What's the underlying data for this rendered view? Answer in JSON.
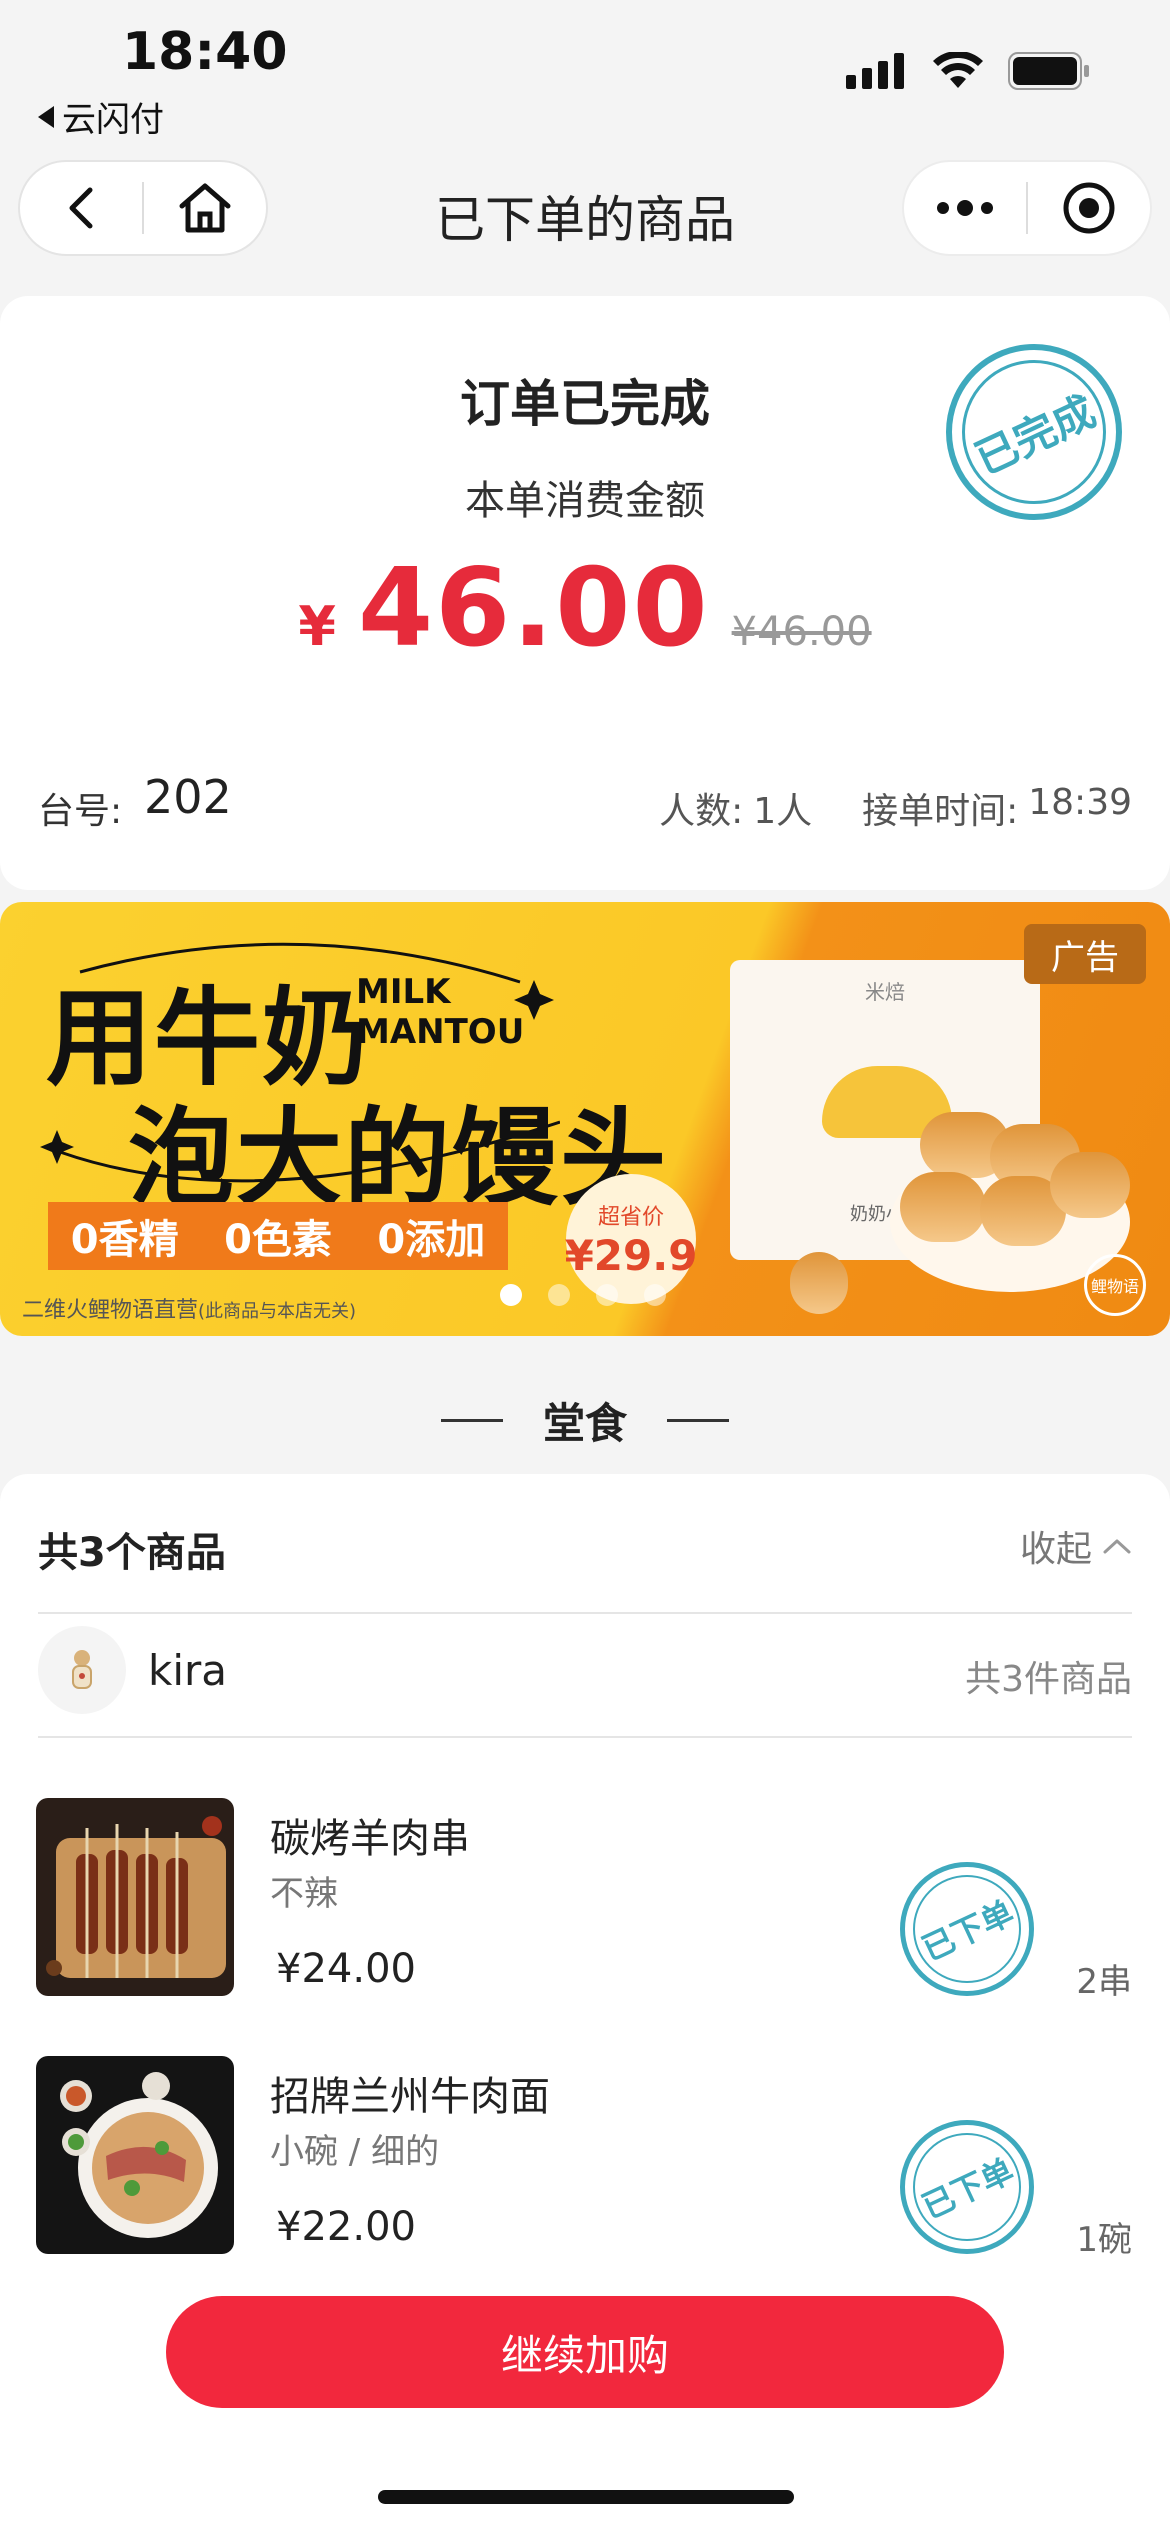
{
  "status_bar": {
    "time": "18:40",
    "back_app": "云闪付"
  },
  "nav": {
    "title": "已下单的商品"
  },
  "order": {
    "status": "订单已完成",
    "amount_label": "本单消费金额",
    "currency_symbol": "¥",
    "amount": "46.00",
    "original_amount": "¥46.00",
    "stamp_text": "已完成",
    "table_label": "台号:",
    "table_number": "202",
    "people_label": "人数:",
    "people_value": "1人",
    "time_label": "接单时间:",
    "time_value": "18:39"
  },
  "ad": {
    "tag": "广告",
    "title_line1": "用牛奶",
    "title_line2": "泡大的馒头",
    "milk_line1": "MILK",
    "milk_line2": "MANTOU",
    "features": [
      "0香精",
      "0色素",
      "0添加"
    ],
    "footnote": "二维火鲤物语直营",
    "footnote_small": "(此商品与本店无关)",
    "price_label": "超省价",
    "price_value": "¥29.9",
    "bag_brand": "米焙",
    "bag_name": "奶奶小馒头",
    "logo_text": "鲤物语",
    "dots_total": 4,
    "dots_active": 0
  },
  "section": {
    "title": "堂食"
  },
  "goods": {
    "count_label": "共3个商品",
    "collapse_label": "收起",
    "user_name": "kira",
    "user_items": "共3件商品",
    "items": [
      {
        "name": "碳烤羊肉串",
        "spec": "不辣",
        "price": "¥24.00",
        "qty": "2串",
        "stamp": "已下单"
      },
      {
        "name": "招牌兰州牛肉面",
        "spec": "小碗 / 细的",
        "price": "¥22.00",
        "qty": "1碗",
        "stamp": "已下单"
      }
    ]
  },
  "actions": {
    "continue_label": "继续加购"
  },
  "colors": {
    "accent_red": "#e62b3b",
    "button_red": "#f2283d",
    "stamp_teal": "#3ea9bd",
    "ad_yellow": "#fbd12f",
    "ad_orange": "#f08a12"
  }
}
